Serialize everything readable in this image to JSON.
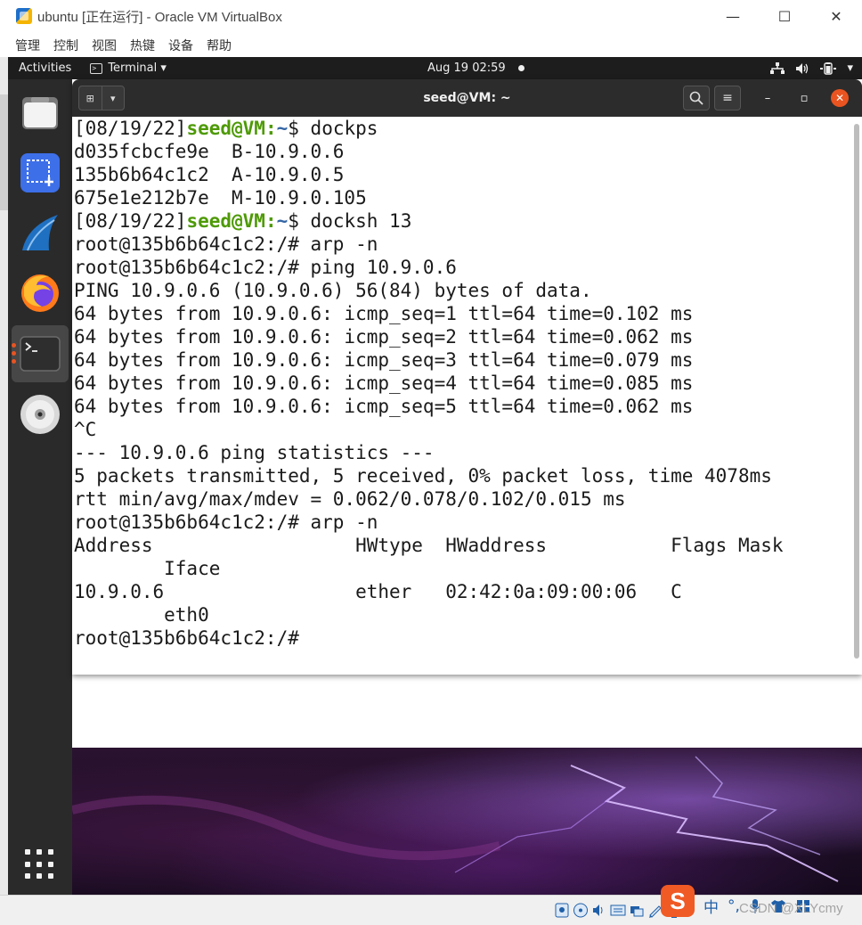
{
  "host_window": {
    "title": "ubuntu [正在运行] - Oracle VM VirtualBox",
    "minimize": "—",
    "maximize": "☐",
    "close": "✕",
    "menu": [
      "管理",
      "控制",
      "视图",
      "热键",
      "设备",
      "帮助"
    ]
  },
  "topbar": {
    "activities": "Activities",
    "app_label": "Terminal ▾",
    "clock": "Aug 19  02:59",
    "status": {
      "network": "⛶",
      "volume": "🔊",
      "battery": "▮",
      "menu_arrow": "▾"
    }
  },
  "dock": {
    "items": [
      "files-icon",
      "screenshot-icon",
      "wireshark-icon",
      "firefox-icon",
      "terminal-icon",
      "disc-icon"
    ]
  },
  "terminal": {
    "title": "seed@VM: ~",
    "new_tab_glyph": "⊞",
    "dropdown_glyph": "▾",
    "search_glyph": "⚲",
    "menu_glyph": "≡",
    "minimize_glyph": "–",
    "maximize_glyph": "▫",
    "close_glyph": "✕",
    "lines": [
      {
        "kind": "prompt",
        "date": "[08/19/22]",
        "host": "seed@VM",
        "colon": ":",
        "path": "~",
        "tail": "$ dockps"
      },
      {
        "kind": "text",
        "text": "d035fcbcfe9e  B-10.9.0.6"
      },
      {
        "kind": "text",
        "text": "135b6b64c1c2  A-10.9.0.5"
      },
      {
        "kind": "text",
        "text": "675e1e212b7e  M-10.9.0.105"
      },
      {
        "kind": "prompt",
        "date": "[08/19/22]",
        "host": "seed@VM",
        "colon": ":",
        "path": "~",
        "tail": "$ docksh 13"
      },
      {
        "kind": "text",
        "text": "root@135b6b64c1c2:/# arp -n"
      },
      {
        "kind": "text",
        "text": "root@135b6b64c1c2:/# ping 10.9.0.6"
      },
      {
        "kind": "text",
        "text": "PING 10.9.0.6 (10.9.0.6) 56(84) bytes of data."
      },
      {
        "kind": "text",
        "text": "64 bytes from 10.9.0.6: icmp_seq=1 ttl=64 time=0.102 ms"
      },
      {
        "kind": "text",
        "text": "64 bytes from 10.9.0.6: icmp_seq=2 ttl=64 time=0.062 ms"
      },
      {
        "kind": "text",
        "text": "64 bytes from 10.9.0.6: icmp_seq=3 ttl=64 time=0.079 ms"
      },
      {
        "kind": "text",
        "text": "64 bytes from 10.9.0.6: icmp_seq=4 ttl=64 time=0.085 ms"
      },
      {
        "kind": "text",
        "text": "64 bytes from 10.9.0.6: icmp_seq=5 ttl=64 time=0.062 ms"
      },
      {
        "kind": "text",
        "text": "^C"
      },
      {
        "kind": "text",
        "text": "--- 10.9.0.6 ping statistics ---"
      },
      {
        "kind": "text",
        "text": "5 packets transmitted, 5 received, 0% packet loss, time 4078ms"
      },
      {
        "kind": "text",
        "text": "rtt min/avg/max/mdev = 0.062/0.078/0.102/0.015 ms"
      },
      {
        "kind": "text",
        "text": "root@135b6b64c1c2:/# arp -n"
      },
      {
        "kind": "text",
        "text": "Address                  HWtype  HWaddress           Flags Mask"
      },
      {
        "kind": "text",
        "text": "        Iface"
      },
      {
        "kind": "text",
        "text": "10.9.0.6                 ether   02:42:0a:09:00:06   C"
      },
      {
        "kind": "text",
        "text": "        eth0"
      },
      {
        "kind": "text",
        "text": "root@135b6b64c1c2:/#"
      }
    ]
  },
  "statusbar": {
    "ime_logo": "S",
    "ime_mode": "中",
    "ime_punct": "°,",
    "ime_mic": "🎤",
    "watermark": "CSDN @XLYcmy"
  },
  "colors": {
    "prompt_host": "#4e9a06",
    "prompt_path": "#3465a4",
    "topbar_bg": "#1d1d1d",
    "dock_bg": "#2a2a2a",
    "close_button": "#e95420"
  }
}
